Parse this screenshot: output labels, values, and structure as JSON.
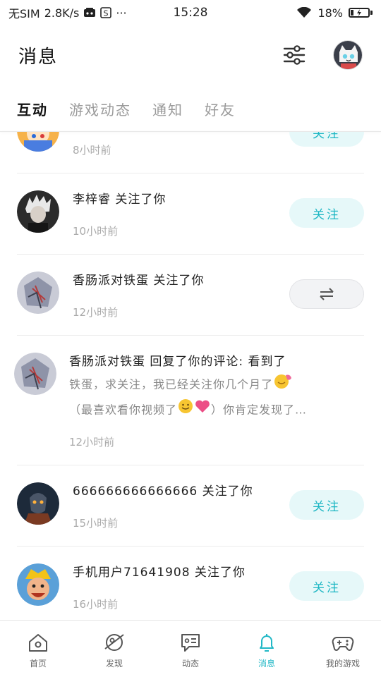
{
  "status_bar": {
    "carrier": "无SIM",
    "speed": "2.8K/s",
    "more": "···",
    "time": "15:28",
    "battery_percent": "18%",
    "battery_level": 0.18
  },
  "header": {
    "title": "消息"
  },
  "tabs": [
    {
      "label": "互动",
      "active": true
    },
    {
      "label": "游戏动态",
      "active": false
    },
    {
      "label": "通知",
      "active": false
    },
    {
      "label": "好友",
      "active": false
    }
  ],
  "items": [
    {
      "title": "",
      "time": "8小时前",
      "action": "关注"
    },
    {
      "title": "李梓睿 关注了你",
      "time": "10小时前",
      "action": "关注"
    },
    {
      "title": "香肠派对铁蛋 关注了你",
      "time": "12小时前",
      "action": "⇄"
    },
    {
      "title": "香肠派对铁蛋 回复了你的评论: 看到了",
      "body_line1": "铁蛋，求关注，我已经关注你几个月了",
      "body_line2_a": "（最喜欢看你视频了",
      "body_line2_b": "）你肯定发现了…",
      "time": "12小时前"
    },
    {
      "title": "666666666666666 关注了你",
      "time": "15小时前",
      "action": "关注"
    },
    {
      "title": "手机用户71641908 关注了你",
      "time": "16小时前",
      "action": "关注"
    }
  ],
  "bottom_nav": [
    {
      "label": "首页",
      "icon": "home-icon",
      "active": false
    },
    {
      "label": "发现",
      "icon": "discover-planet-icon",
      "active": false
    },
    {
      "label": "动态",
      "icon": "feed-chat-icon",
      "active": false
    },
    {
      "label": "消息",
      "icon": "bell-icon",
      "active": true
    },
    {
      "label": "我的游戏",
      "icon": "gamepad-icon",
      "active": false
    }
  ],
  "colors": {
    "accent": "#22b8c6",
    "follow_bg": "#e6f8f9",
    "muted_text": "#aaaaaa"
  }
}
